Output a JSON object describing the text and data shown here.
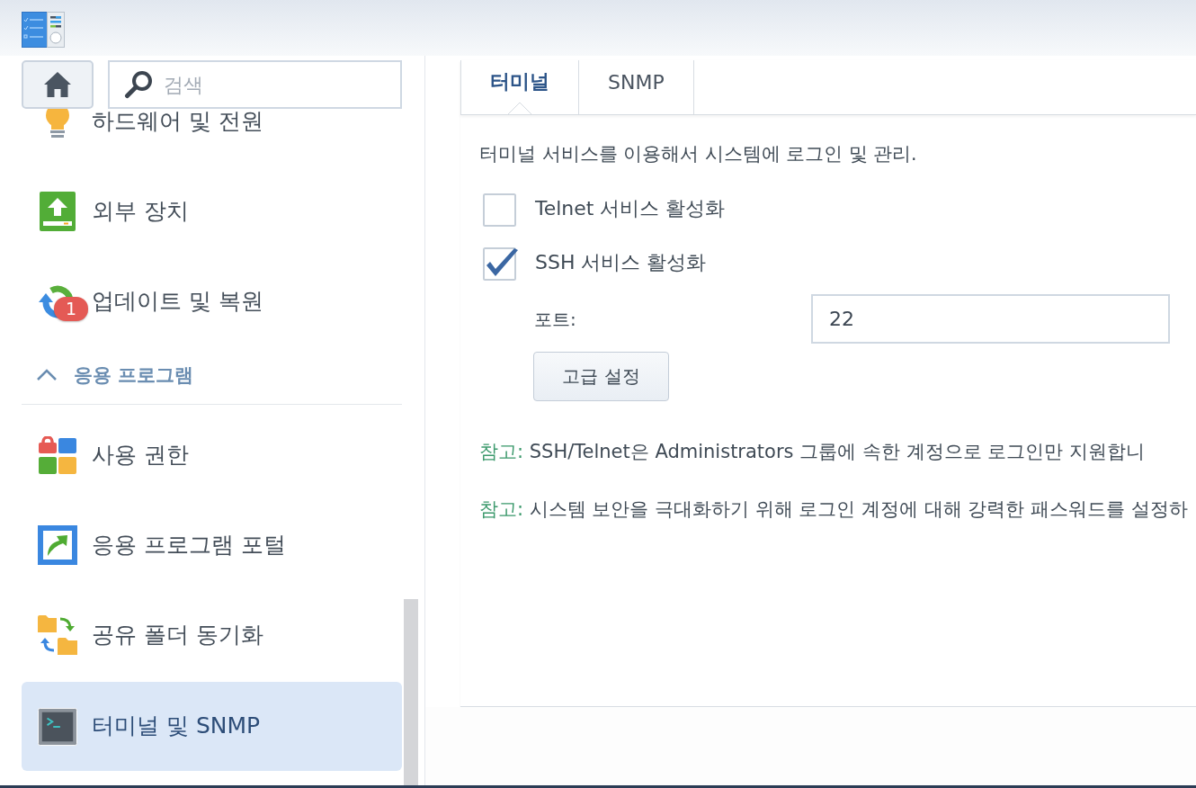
{
  "sidebar": {
    "search": {
      "placeholder": "검색"
    },
    "items": [
      {
        "label": "하드웨어 및 전원",
        "selected": false
      },
      {
        "label": "외부 장치",
        "selected": false
      },
      {
        "label": "업데이트 및 복원",
        "selected": false,
        "badge": "1"
      }
    ],
    "sections": [
      {
        "title": "응용 프로그램",
        "expanded": true,
        "items": [
          {
            "label": "사용 권한",
            "selected": false
          },
          {
            "label": "응용 프로그램 포털",
            "selected": false
          },
          {
            "label": "공유 폴더 동기화",
            "selected": false
          },
          {
            "label": "터미널 및 SNMP",
            "selected": true
          }
        ]
      }
    ]
  },
  "tabs": [
    {
      "label": "터미널",
      "selected": true
    },
    {
      "label": "SNMP",
      "selected": false
    }
  ],
  "description": "터미널 서비스를 이용해서 시스템에 로그인 및 관리.",
  "options": [
    {
      "label": "Telnet 서비스 활성화",
      "checked": false
    },
    {
      "label": "SSH 서비스 활성화",
      "checked": true
    }
  ],
  "port": {
    "label": "포트:",
    "value": "22"
  },
  "advanced_button": {
    "label": "고급 설정"
  },
  "notes": [
    {
      "label": "참고:",
      "text": "SSH/Telnet은 Administrators 그룹에 속한 계정으로 로그인만 지원합니"
    },
    {
      "label": "참고:",
      "text": "시스템 보안을 극대화하기 위해 로그인 계정에 대해 강력한 패스워드를 설정하"
    }
  ]
}
